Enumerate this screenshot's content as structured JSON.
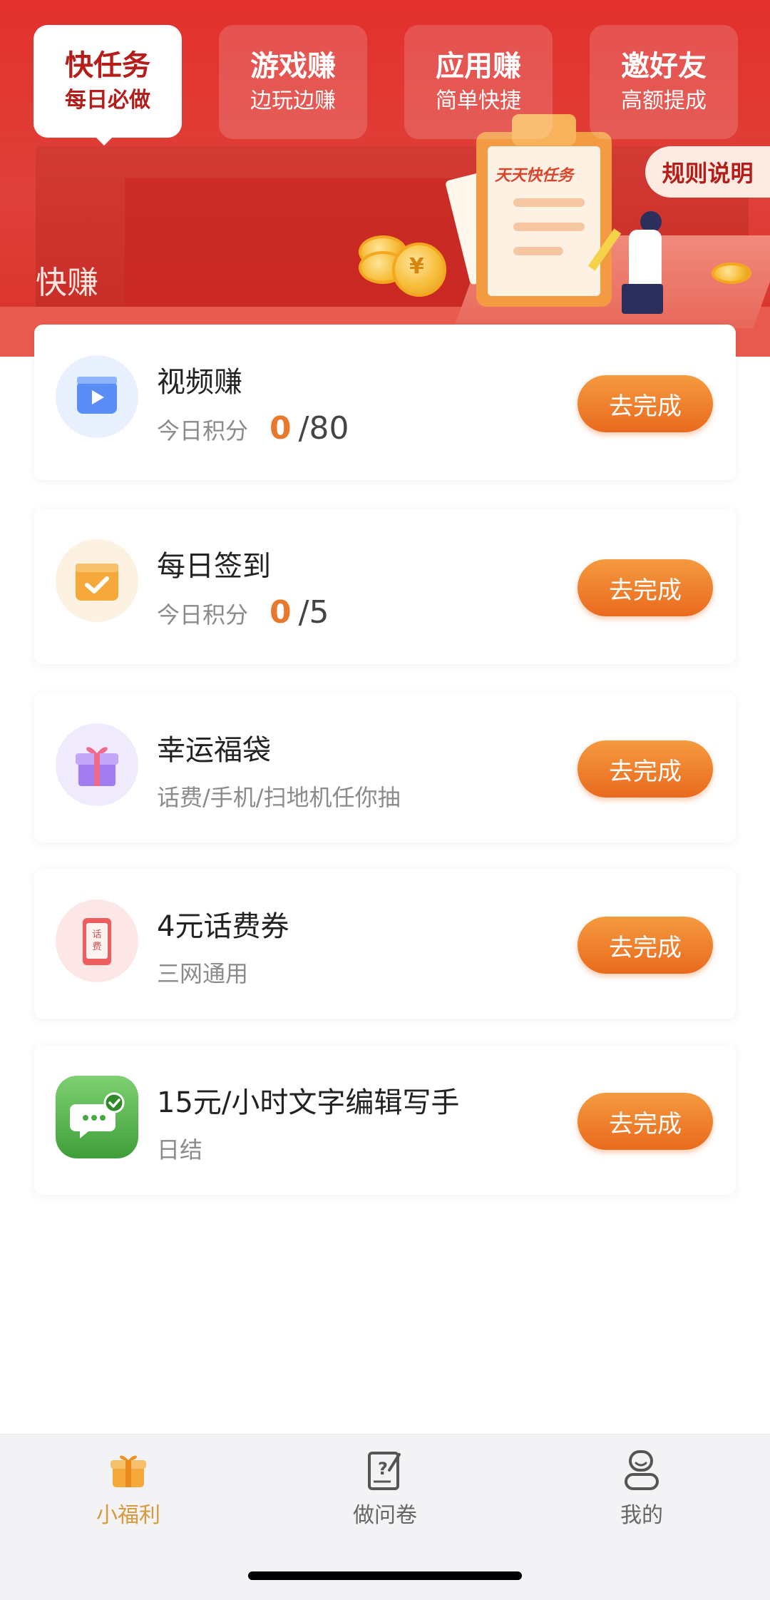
{
  "header": {
    "tabs": [
      {
        "title": "快任务",
        "subtitle": "每日必做",
        "active": true
      },
      {
        "title": "游戏赚",
        "subtitle": "边玩边赚",
        "active": false
      },
      {
        "title": "应用赚",
        "subtitle": "简单快捷",
        "active": false
      },
      {
        "title": "邀好友",
        "subtitle": "高额提成",
        "active": false
      }
    ],
    "rules_label": "规则说明",
    "section_title": "快赚",
    "illustration_text": "天天快任务",
    "coin_symbol": "¥"
  },
  "tasks": [
    {
      "title": "视频赚",
      "sub_label": "今日积分",
      "score_current": "0",
      "score_max": "80",
      "button": "去完成",
      "icon": "video-icon"
    },
    {
      "title": "每日签到",
      "sub_label": "今日积分",
      "score_current": "0",
      "score_max": "5",
      "button": "去完成",
      "icon": "calendar-check-icon"
    },
    {
      "title": "幸运福袋",
      "sub_label": "话费/手机/扫地机任你抽",
      "button": "去完成",
      "icon": "gift-box-icon"
    },
    {
      "title": "4元话费券",
      "sub_label": "三网通用",
      "button": "去完成",
      "icon": "phone-bill-icon",
      "icon_text": "话费"
    },
    {
      "title": "15元/小时文字编辑写手",
      "sub_label": "日结",
      "button": "去完成",
      "icon": "chat-check-icon"
    }
  ],
  "bottom_nav": [
    {
      "label": "小福利",
      "icon": "gift-icon",
      "active": true
    },
    {
      "label": "做问卷",
      "icon": "questionnaire-icon",
      "active": false
    },
    {
      "label": "我的",
      "icon": "profile-icon",
      "active": false
    }
  ],
  "colors": {
    "header_red": "#e2302c",
    "button_orange": "#ea6a1e",
    "score_orange": "#e8782c",
    "active_nav": "#d89a3a"
  }
}
